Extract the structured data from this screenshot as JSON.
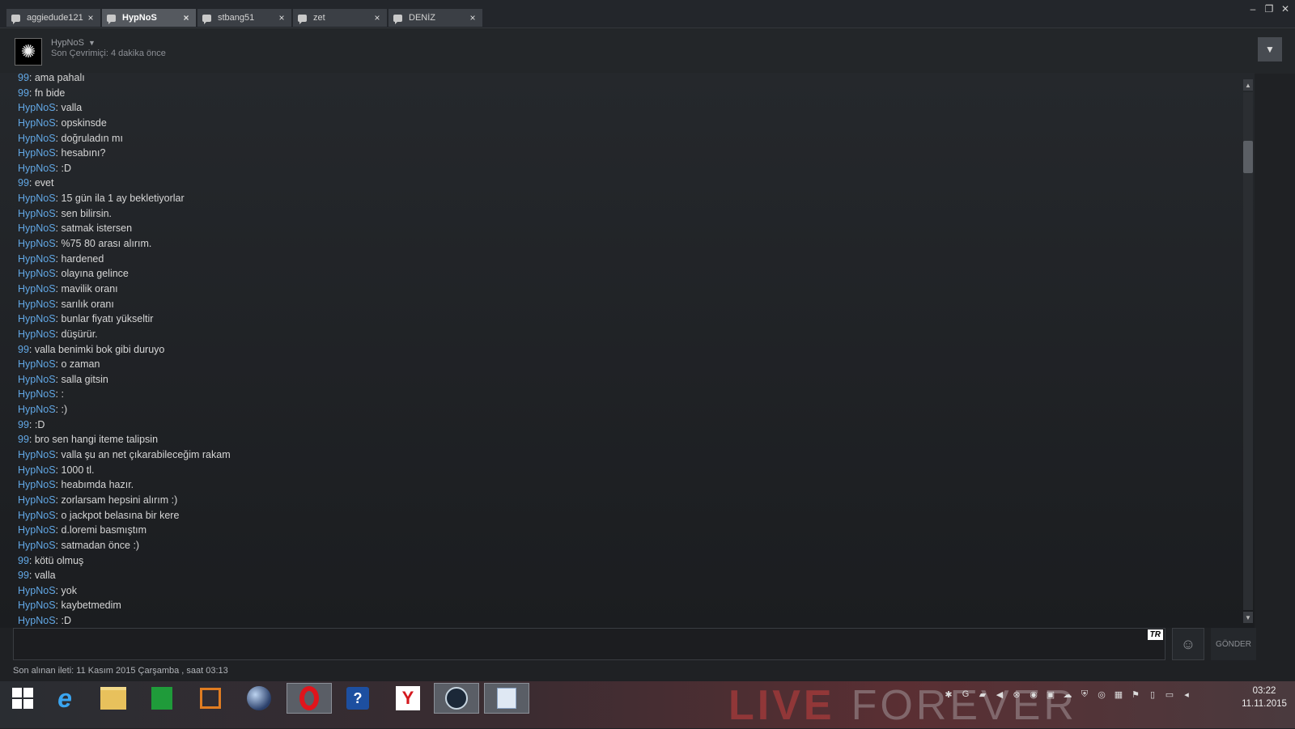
{
  "tabs": [
    {
      "label": "aggiedude121",
      "active": false
    },
    {
      "label": "HypNoS",
      "active": true
    },
    {
      "label": "stbang51",
      "active": false
    },
    {
      "label": "zet",
      "active": false
    },
    {
      "label": "DENİZ",
      "active": false
    }
  ],
  "window_controls": {
    "minimize": "–",
    "restore": "❐",
    "close": "✕"
  },
  "header": {
    "name": "HypNoS",
    "status": "Son Çevrimiçi: 4 dakika önce",
    "dropdown_icon": "▼"
  },
  "messages": [
    {
      "sender": "99",
      "text": ": ama pahalı"
    },
    {
      "sender": "99",
      "text": ": fn bide"
    },
    {
      "sender": "HypNoS",
      "text": ": valla"
    },
    {
      "sender": "HypNoS",
      "text": ": opskinsde"
    },
    {
      "sender": "HypNoS",
      "text": ": doğruladın mı"
    },
    {
      "sender": "HypNoS",
      "text": ": hesabını?"
    },
    {
      "sender": "HypNoS",
      "text": ": :D"
    },
    {
      "sender": "99",
      "text": ": evet"
    },
    {
      "sender": "HypNoS",
      "text": ": 15 gün ila 1 ay bekletiyorlar"
    },
    {
      "sender": "HypNoS",
      "text": ": sen bilirsin."
    },
    {
      "sender": "HypNoS",
      "text": ": satmak istersen"
    },
    {
      "sender": "HypNoS",
      "text": ": %75 80 arası alırım."
    },
    {
      "sender": "HypNoS",
      "text": ": hardened"
    },
    {
      "sender": "HypNoS",
      "text": ": olayına gelince"
    },
    {
      "sender": "HypNoS",
      "text": ": mavilik oranı"
    },
    {
      "sender": "HypNoS",
      "text": ": sarılık oranı"
    },
    {
      "sender": "HypNoS",
      "text": ": bunlar fiyatı yükseltir"
    },
    {
      "sender": "HypNoS",
      "text": ": düşürür."
    },
    {
      "sender": "99",
      "text": ": valla benimki bok gibi duruyo"
    },
    {
      "sender": "HypNoS",
      "text": ": o zaman"
    },
    {
      "sender": "HypNoS",
      "text": ": salla gitsin"
    },
    {
      "sender": "HypNoS",
      "text": ": :"
    },
    {
      "sender": "HypNoS",
      "text": ": :)"
    },
    {
      "sender": "99",
      "text": ": :D"
    },
    {
      "sender": "99",
      "text": ": bro sen hangi iteme talipsin"
    },
    {
      "sender": "HypNoS",
      "text": ": valla şu an net çıkarabileceğim rakam"
    },
    {
      "sender": "HypNoS",
      "text": ": 1000 tl."
    },
    {
      "sender": "HypNoS",
      "text": ": heabımda hazır."
    },
    {
      "sender": "HypNoS",
      "text": ": zorlarsam hepsini alırım :)"
    },
    {
      "sender": "HypNoS",
      "text": ": o jackpot belasına bir kere"
    },
    {
      "sender": "HypNoS",
      "text": ": d.loremi basmıştım"
    },
    {
      "sender": "HypNoS",
      "text": ": satmadan önce :)"
    },
    {
      "sender": "99",
      "text": ": kötü olmuş"
    },
    {
      "sender": "99",
      "text": ": valla"
    },
    {
      "sender": "HypNoS",
      "text": ": yok"
    },
    {
      "sender": "HypNoS",
      "text": ": kaybetmedim"
    },
    {
      "sender": "HypNoS",
      "text": ": :D"
    }
  ],
  "composer": {
    "language_badge": "TR",
    "emoji_icon": "☺",
    "send_label": "GÖNDER",
    "last_received": "Son alınan ileti: 11 Kasım 2015 Çarşamba , saat 03:13"
  },
  "taskbar": {
    "watermark_bold": "LIVE",
    "watermark_thin": "FOREVER",
    "apps": [
      {
        "icon": "windows-start-icon"
      },
      {
        "icon": "internet-explorer-icon"
      },
      {
        "icon": "file-explorer-icon"
      },
      {
        "icon": "store-icon"
      },
      {
        "icon": "office-icon"
      },
      {
        "icon": "globe-icon"
      },
      {
        "icon": "opera-icon"
      },
      {
        "icon": "help-icon"
      },
      {
        "icon": "yandex-icon"
      },
      {
        "icon": "steam-icon"
      },
      {
        "icon": "paint-icon"
      }
    ],
    "clock_time": "03:22",
    "clock_date": "11.11.2015"
  },
  "colors": {
    "sender": "#62a8e6",
    "text": "#d6d6d6",
    "background": "#1f2124"
  }
}
